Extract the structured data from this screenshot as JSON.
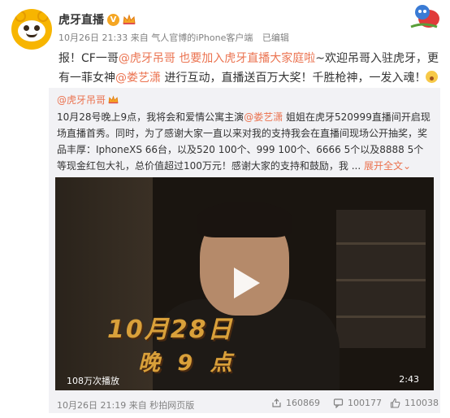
{
  "post": {
    "username": "虎牙直播",
    "verified_mark": "V",
    "timestamp": "10月26日 21:33",
    "source_prefix": "来自",
    "source": "气人官博的iPhone客户端",
    "edited": "已编辑",
    "text": {
      "p1": "报！CF一哥",
      "m1": "@虎牙吊哥",
      "p2": " ",
      "l1": "也要加入虎牙直播大家庭啦",
      "p3": "~欢迎吊哥入驻虎牙，更有一菲女神",
      "m2": "@娄艺潇",
      "p4": " 进行互动，直播送百万大奖！千胜枪神，一发入魂！"
    }
  },
  "repost": {
    "username": "@虎牙吊哥",
    "text": {
      "p1": "10月28号晚上9点，我将会和爱情公寓主演",
      "m1": "@娄艺潇",
      "p2": " 姐姐在虎牙520999直播间开启现场直播首秀。同时，为了感谢大家一直以来对我的支持我会在直播间现场公开抽奖，奖品丰厚：IphoneXS 66台，以及520 100个、999 100个、6666 5个以及8888 5个 等现金红包大礼，总价值超过100万元！感谢大家的支持和鼓励，我 ... ",
      "expand": "展开全文",
      "expand_arrow": "⌄"
    },
    "video": {
      "date_overlay": "10月28日",
      "time_overlay": "晚 9 点",
      "plays": "108万次播放",
      "duration": "2:43"
    },
    "footer": {
      "timestamp": "10月26日 21:19",
      "source_prefix": "来自",
      "source": "秒拍网页版",
      "reposts": "160869",
      "comments": "100177",
      "likes": "110038"
    }
  },
  "colors": {
    "link": "#eb7350",
    "meta": "#808080",
    "repost_bg": "#f2f2f5",
    "badge": "#f5a623"
  }
}
